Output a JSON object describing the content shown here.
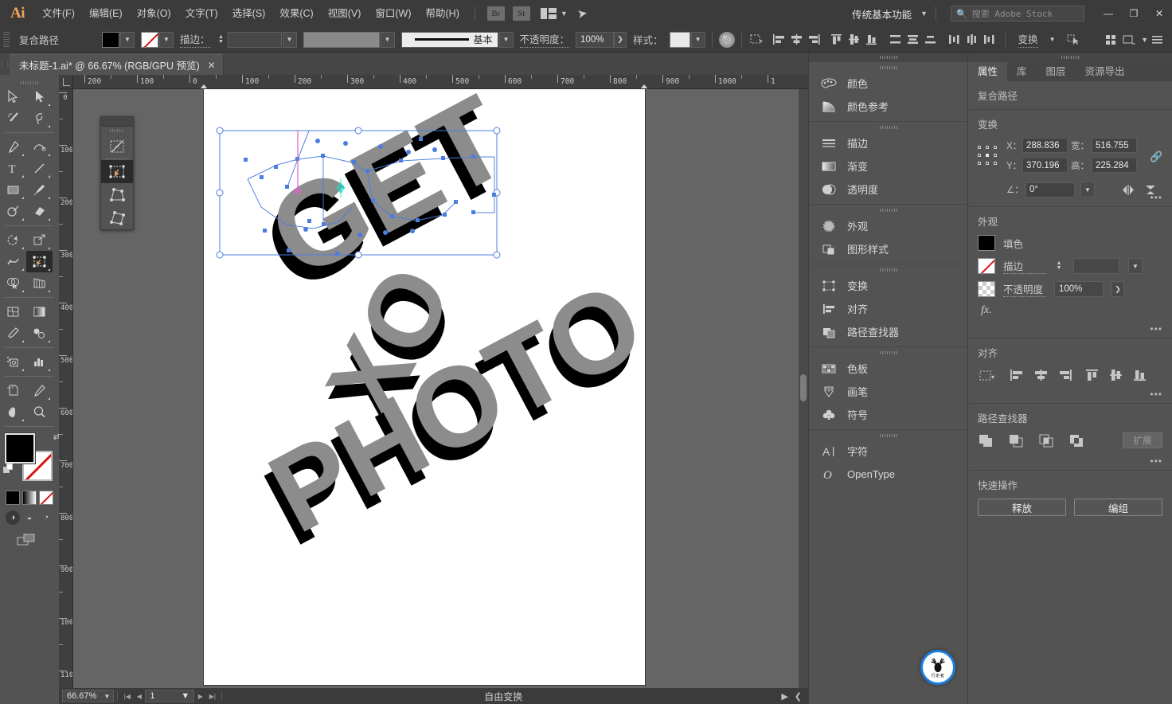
{
  "app": {
    "logo": "Ai"
  },
  "menubar": {
    "items": [
      {
        "label": "文件(F)"
      },
      {
        "label": "编辑(E)"
      },
      {
        "label": "对象(O)"
      },
      {
        "label": "文字(T)"
      },
      {
        "label": "选择(S)"
      },
      {
        "label": "效果(C)"
      },
      {
        "label": "视图(V)"
      },
      {
        "label": "窗口(W)"
      },
      {
        "label": "帮助(H)"
      }
    ],
    "bridge_label": "Br",
    "stock_label": "St",
    "workspace": "传统基本功能",
    "search_placeholder": "搜索 Adobe Stock",
    "window_min": "—",
    "window_max": "❐",
    "window_close": "✕"
  },
  "controlbar": {
    "object_type": "复合路径",
    "fill_swatch": "black",
    "stroke_swatch": "none",
    "stroke_label": "描边：",
    "stroke_weight": "",
    "brush_label": "基本",
    "opacity_label": "不透明度：",
    "opacity_value": "100%",
    "style_label": "样式：",
    "transform_label": "变换"
  },
  "tabbar": {
    "doc_title": "未标题-1.ai* @ 66.67% (RGB/GPU 预览)",
    "close": "✕"
  },
  "rulers": {
    "h_labels": [
      "200",
      "100",
      "0",
      "100",
      "200",
      "300",
      "400",
      "500",
      "600",
      "700",
      "800",
      "900",
      "1000",
      "1"
    ],
    "v_labels": [
      "0",
      "100",
      "200",
      "300",
      "400",
      "500",
      "600",
      "700",
      "800",
      "900",
      "1000",
      "1100"
    ]
  },
  "artwork": {
    "line1": "GET",
    "line2": "XO",
    "line3": "PHOTO",
    "fill_color": "#8c8c8c",
    "shadow_color": "#000000",
    "selection_color": "#4a7ddf"
  },
  "statusbar": {
    "zoom": "66.67%",
    "page": "1",
    "tool_status": "自由变换"
  },
  "dock": {
    "groups": [
      {
        "items": [
          {
            "label": "颜色",
            "icon": "palette-icon"
          },
          {
            "label": "颜色参考",
            "icon": "color-guide-icon"
          }
        ]
      },
      {
        "items": [
          {
            "label": "描边",
            "icon": "stroke-icon"
          },
          {
            "label": "渐变",
            "icon": "gradient-icon"
          },
          {
            "label": "透明度",
            "icon": "transparency-icon"
          }
        ]
      },
      {
        "items": [
          {
            "label": "外观",
            "icon": "appearance-icon"
          },
          {
            "label": "图形样式",
            "icon": "graphic-styles-icon"
          }
        ]
      },
      {
        "items": [
          {
            "label": "变换",
            "icon": "transform-icon"
          },
          {
            "label": "对齐",
            "icon": "align-icon"
          },
          {
            "label": "路径查找器",
            "icon": "pathfinder-icon"
          }
        ]
      },
      {
        "items": [
          {
            "label": "色板",
            "icon": "swatches-icon"
          },
          {
            "label": "画笔",
            "icon": "brushes-icon"
          },
          {
            "label": "符号",
            "icon": "symbols-icon"
          }
        ]
      },
      {
        "items": [
          {
            "label": "字符",
            "icon": "character-icon"
          },
          {
            "label": "OpenType",
            "icon": "opentype-icon"
          }
        ]
      }
    ]
  },
  "properties": {
    "tabs": [
      "属性",
      "库",
      "图层",
      "资源导出"
    ],
    "active_tab": "属性",
    "object_label": "复合路径",
    "transform": {
      "title": "变换",
      "x_label": "X：",
      "x_value": "288.836",
      "y_label": "Y：",
      "y_value": "370.196",
      "w_label": "宽：",
      "w_value": "516.755",
      "h_label": "高：",
      "h_value": "225.284",
      "angle_label": "∠：",
      "angle_value": "0°",
      "ellipsis": "•••"
    },
    "appearance": {
      "title": "外观",
      "fill_label": "填色",
      "stroke_label": "描边",
      "stroke_weight": "",
      "opacity_label": "不透明度",
      "opacity_value": "100%",
      "fx_label": "fx.",
      "ellipsis": "•••"
    },
    "align": {
      "title": "对齐",
      "ellipsis": "•••"
    },
    "pathfinder": {
      "title": "路径查找器",
      "expand_label": "扩展",
      "ellipsis": "•••"
    },
    "quick_actions": {
      "title": "快速操作",
      "release_label": "释放",
      "group_label": "编组"
    }
  },
  "toolbar": {
    "tools": [
      "selection-tool",
      "direct-selection-tool",
      "magic-wand-tool",
      "lasso-tool",
      "pen-tool",
      "curvature-tool",
      "type-tool",
      "line-segment-tool",
      "rectangle-tool",
      "paintbrush-tool",
      "shaper-tool",
      "eraser-tool",
      "rotate-tool",
      "scale-tool",
      "width-tool",
      "free-transform-tool",
      "shape-builder-tool",
      "perspective-grid-tool",
      "mesh-tool",
      "gradient-tool",
      "eyedropper-tool",
      "blend-tool",
      "symbol-sprayer-tool",
      "column-graph-tool",
      "artboard-tool",
      "slice-tool",
      "hand-tool",
      "zoom-tool"
    ],
    "selected_tool": "free-transform-tool",
    "fill_color": "#000000",
    "stroke_color": "none"
  },
  "float_panel": {
    "tools": [
      "free-distort-tool",
      "free-transform-selected-tool",
      "perspective-distort-tool",
      "free-distort-2-tool"
    ],
    "selected": "free-transform-selected-tool"
  },
  "watermark": {
    "text": "行走者"
  }
}
